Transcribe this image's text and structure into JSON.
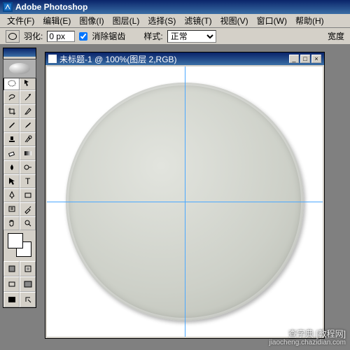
{
  "app": {
    "title": "Adobe Photoshop"
  },
  "menu": {
    "file": "文件(F)",
    "edit": "编辑(E)",
    "image": "图像(I)",
    "layer": "图层(L)",
    "select": "选择(S)",
    "filter": "滤镜(T)",
    "view": "视图(V)",
    "window": "窗口(W)",
    "help": "帮助(H)"
  },
  "options": {
    "feather_label": "羽化:",
    "feather_value": "0 px",
    "antialias_label": "消除锯齿",
    "style_label": "样式:",
    "style_value": "正常",
    "width_label": "宽度"
  },
  "doc": {
    "title": "未标题-1 @ 100%(图层 2,RGB)"
  },
  "tools": {
    "marquee": "marquee",
    "move": "move",
    "lasso": "lasso",
    "wand": "wand",
    "crop": "crop",
    "slice": "slice",
    "heal": "heal",
    "brush": "brush",
    "stamp": "stamp",
    "history": "history",
    "eraser": "eraser",
    "gradient": "gradient",
    "blur": "blur",
    "dodge": "dodge",
    "path": "path",
    "type": "type",
    "pen": "pen",
    "shape": "shape",
    "notes": "notes",
    "eyedrop": "eyedrop",
    "hand": "hand",
    "zoom": "zoom"
  },
  "watermark": {
    "main": "查字典 [教程网]",
    "sub": "jiaocheng.chazidian.com"
  }
}
